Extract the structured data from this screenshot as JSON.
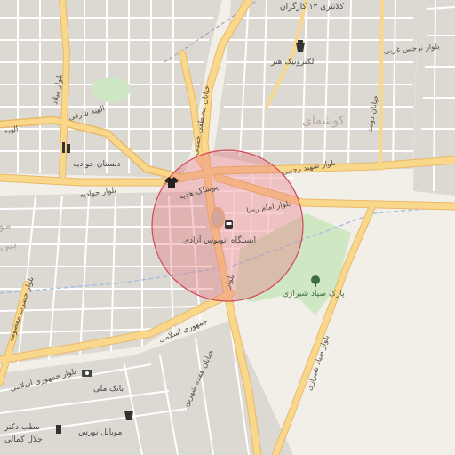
{
  "map": {
    "colors": {
      "background": "#f2efe9",
      "block": "#dcd8d2",
      "minor_road": "#ffffff",
      "major_road": "#f9d88c",
      "major_road_casing": "#e8b96a",
      "park": "#cfe7c3",
      "railway": "#a8c0e0",
      "highlight_fill": "#e8707c",
      "highlight_stroke": "#d2485a"
    },
    "labels": {
      "kalantari_3": "کلانتری ۱۳ کارگران",
      "electronic_honar": "الکترونیک هنر",
      "narges_gharbi": "بلوار نرجس غربی",
      "kooshe": "کوشه‌ای",
      "khiaban_dolat": "خیابان دولت",
      "mostafa_khomeini": "خیابان مصطفی خمینی",
      "elahiye_sharghi": "الهیه شرقی",
      "elahiye": "الهیه",
      "milad": "بلوار میلاد",
      "dabestan_javadiye": "دبستان جوادیه",
      "bolvar_javadiye": "بلوار جوادیه",
      "pooshak_hediye": "پوشاک هدیه",
      "shahid_rajaei": "بلوار شهید رجایی",
      "imam_reza": "بلوار امام رضا",
      "bus_station": "ایستگاه اتوبوس آزادی",
      "bolvar": "بلوار",
      "jomhoori_eslami": "جمهوری اسلامی",
      "bolvar_jomhoori_eslami": "بلوار جمهوری اسلامی",
      "park_sayad": "پارک صیاد شیرازی",
      "bolvar_sayad": "بلوار صیاد شیرازی",
      "hazrat_masoume": "بلوار حضرت معصومه",
      "bank_melli": "بانک ملی",
      "shahrivar_17": "خیابان هفده شهریور",
      "matab_doctor": "مطب دکتر",
      "jalal_kamali": "جلال کمالی",
      "mobile_noros": "موبایل نورس",
      "bani": "بنی",
      "so": "مو"
    },
    "icons": [
      "clothing-shop-icon",
      "bus-stop-icon",
      "school-icon",
      "electronics-shop-icon",
      "tree-icon",
      "bank-icon",
      "medical-icon",
      "phone-shop-icon"
    ]
  }
}
